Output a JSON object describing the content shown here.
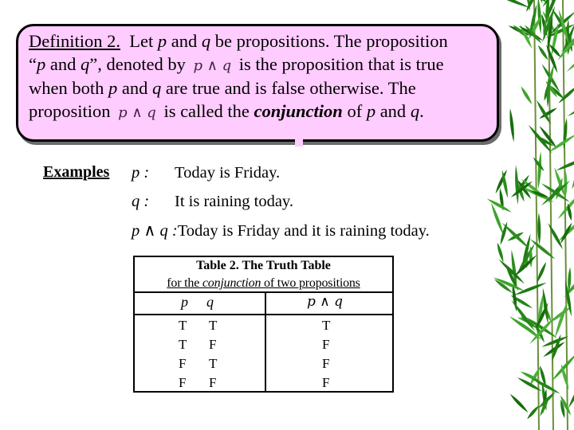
{
  "definition": {
    "heading": "Definition 2.",
    "line1_a": "Let ",
    "p": "p",
    "and": " and ",
    "q": "q",
    "line1_b": " be propositions. The proposition",
    "line2_open": "“",
    "line2_quote_and": " and ",
    "line2_close": "”, denoted by ",
    "conj_symbol": "p ∧ q",
    "line2_b": " is the proposition that is true",
    "line3_a": "when both ",
    "line3_b": " are true and is false otherwise. The",
    "line4_a": "proposition ",
    "line4_b": " is called the ",
    "term": "conjunction",
    "line4_c": " of ",
    "period": "."
  },
  "examples": {
    "label": "Examples",
    "rows": [
      {
        "var": "p :",
        "text": "Today is Friday."
      },
      {
        "var": "q :",
        "text": "It is raining today."
      },
      {
        "var": "p ∧ q :",
        "text": "Today is Friday and it is raining today."
      }
    ]
  },
  "truth_table": {
    "caption_bold": "Table 2.",
    "caption_rest": "  The Truth Table",
    "caption2_a": "for the ",
    "caption2_italic": "conjunction",
    "caption2_b": " of two propositions",
    "headers": [
      "p",
      "q",
      "p ∧ q"
    ],
    "rows": [
      [
        "T",
        "T",
        "T"
      ],
      [
        "T",
        "F",
        "F"
      ],
      [
        "F",
        "T",
        "F"
      ],
      [
        "F",
        "F",
        "F"
      ]
    ]
  },
  "colors": {
    "box_fill": "#ffccff",
    "bamboo": "#2e8b1e"
  }
}
